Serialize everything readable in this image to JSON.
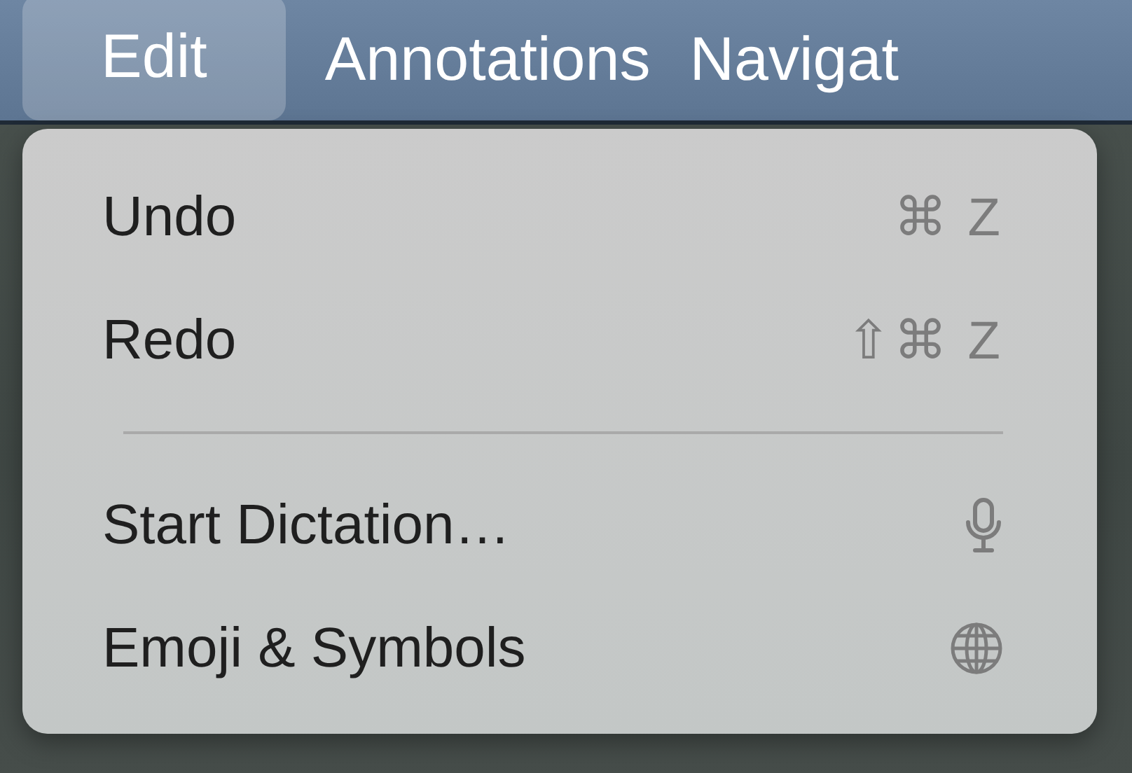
{
  "menu_bar": [
    {
      "label": "Edit",
      "selected": true
    },
    {
      "label": "Annotations",
      "selected": false
    },
    {
      "label": "Navigat",
      "selected": false
    }
  ],
  "edit_menu": {
    "items": [
      {
        "kind": "shortcut",
        "label": "Undo",
        "shortcut": "⌘ Z"
      },
      {
        "kind": "shortcut",
        "label": "Redo",
        "shortcut": "⇧⌘ Z"
      },
      {
        "kind": "separator"
      },
      {
        "kind": "dictation",
        "label": "Start Dictation…"
      },
      {
        "kind": "emoji",
        "label": "Emoji & Symbols"
      }
    ]
  }
}
